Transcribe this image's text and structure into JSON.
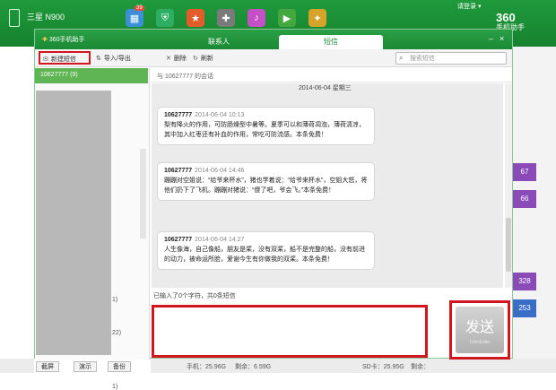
{
  "background": {
    "device_name": "三星 N900",
    "login_text": "请登录 ▾",
    "logo_main": "360",
    "logo_sub": "手机助手",
    "badge": "39",
    "stats": [
      "67",
      "66",
      "328",
      "253"
    ],
    "bottom": {
      "phone_storage": "手机：25.96G",
      "phone_free": "剩余：6.59G",
      "sd_storage": "SD卡：25.95G",
      "sd_free": "剩余："
    },
    "bottom_buttons": [
      "截屏",
      "演示",
      "备份"
    ]
  },
  "window": {
    "title": "360手机助手",
    "tabs": {
      "contacts": "联系人",
      "sms": "短信"
    },
    "min_glyph": "–",
    "close_glyph": "×"
  },
  "toolbar": {
    "new_sms": "新建短信",
    "import_export": "导入/导出",
    "delete": "删除",
    "refresh": "刷新",
    "search_placeholder": "搜索短信"
  },
  "conversation_list": {
    "selected": "10627777 (9)",
    "fragments": [
      "1)",
      "22)",
      "1)"
    ]
  },
  "chat": {
    "header": "与 10627777 的会话",
    "date": "2014-06-04 星期三",
    "messages": [
      {
        "sender": "10627777",
        "time": "2014-06-04 10:13",
        "text": "梨有降火的作用，可防肠燥型中暑等。夏季可以和薄荷凋泡，薄荷清凉，其中加入红枣还有补血的作用，常吃可防流感。本条免费！"
      },
      {
        "sender": "10627777",
        "time": "2014-06-04 14:46",
        "text": "蹦蹦对空姐说：“给爷来杯水”，猪也学着说：“给爷来杯水”，空姐大怒，将他们扔下了飞机。蹦蹦对猪说：“傻了吧，爷会飞。”本条免费！"
      },
      {
        "sender": "10627777",
        "time": "2014-06-04 14:27",
        "text": "人生像海，自己像船，朋友是桨，没有双桨，船不是完整的船，没有前进的动力，被命运所脸，爱谢今生有你做我的双桨。本条免费！"
      }
    ]
  },
  "compose": {
    "counter": "已输入了0个字符，共0条短信",
    "send_label": "发送",
    "send_hint": "Ctrl+Enter"
  }
}
